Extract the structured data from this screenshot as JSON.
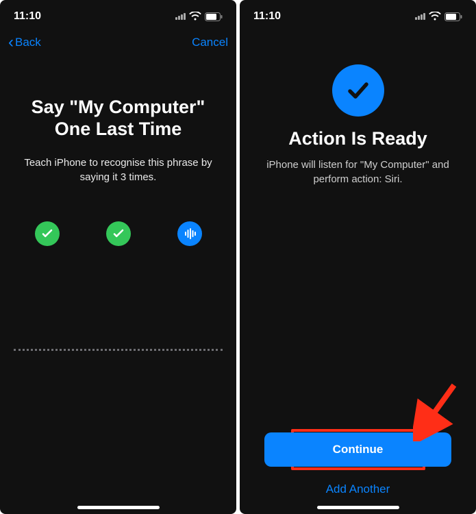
{
  "left": {
    "status_time": "11:10",
    "back_label": "Back",
    "cancel_label": "Cancel",
    "title_line1": "Say \"My Computer\"",
    "title_line2": "One Last Time",
    "subtitle": "Teach iPhone to recognise this phrase by saying it 3 times.",
    "indicators": [
      "check",
      "check",
      "listening"
    ]
  },
  "right": {
    "status_time": "11:10",
    "title": "Action Is Ready",
    "subtitle": "iPhone will listen for \"My Computer\" and perform action: Siri.",
    "continue_label": "Continue",
    "add_another_label": "Add Another"
  },
  "icons": {
    "back_chevron": "‹"
  },
  "colors": {
    "accent": "#0a84ff",
    "success": "#34c759",
    "highlight_box": "#ff2e17"
  }
}
